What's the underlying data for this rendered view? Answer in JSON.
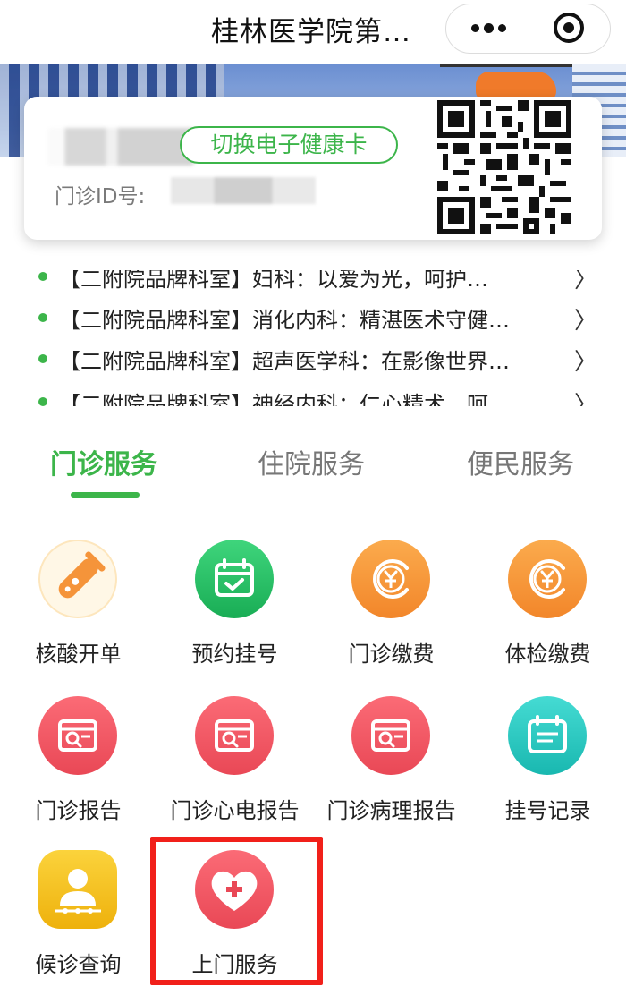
{
  "header": {
    "title": "桂林医学院第…"
  },
  "card": {
    "switch_label": "切换电子健康卡",
    "id_label": "门诊ID号:"
  },
  "news": [
    "【二附院品牌科室】妇科：以爱为光，呵护…",
    "【二附院品牌科室】消化内科：精湛医术守健…",
    "【二附院品牌科室】超声医学科：在影像世界…",
    "【二附院品牌科室】神经内科：仁心精术，呵…"
  ],
  "tabs": [
    "门诊服务",
    "住院服务",
    "便民服务"
  ],
  "services": [
    {
      "label": "核酸开单",
      "icon": "test-tube-icon"
    },
    {
      "label": "预约挂号",
      "icon": "calendar-check-icon"
    },
    {
      "label": "门诊缴费",
      "icon": "yuan-coin-icon"
    },
    {
      "label": "体检缴费",
      "icon": "yuan-coin-icon"
    },
    {
      "label": "门诊报告",
      "icon": "report-icon"
    },
    {
      "label": "门诊心电报告",
      "icon": "report-icon"
    },
    {
      "label": "门诊病理报告",
      "icon": "report-icon"
    },
    {
      "label": "挂号记录",
      "icon": "clipboard-icon"
    },
    {
      "label": "候诊查询",
      "icon": "person-queue-icon"
    },
    {
      "label": "上门服务",
      "icon": "heart-plus-icon"
    }
  ],
  "colors": {
    "accent": "#3cb54a",
    "orange": "#f5943a",
    "red": "#ef5562",
    "teal": "#2cc7c0",
    "yellow": "#f4c21c",
    "highlight": "#f1201a"
  }
}
